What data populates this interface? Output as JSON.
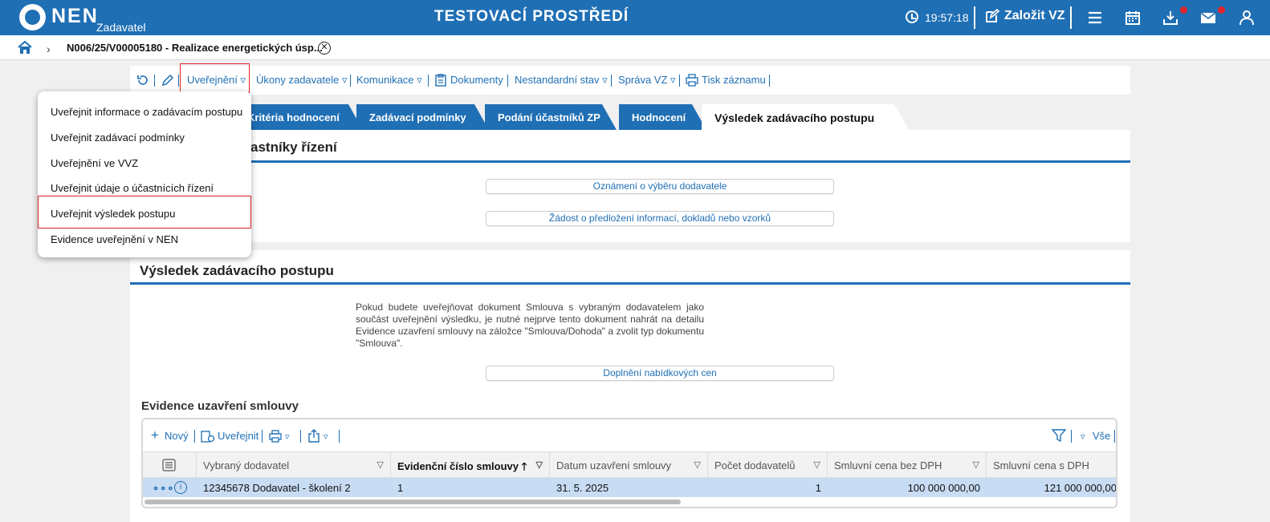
{
  "header": {
    "logo": "NEN",
    "logo_sub": "Zadavatel",
    "env_title": "TESTOVACÍ PROSTŘEDÍ",
    "time": "19:57:18",
    "create_label": "Založit VZ"
  },
  "breadcrumb": {
    "title": "N006/25/V00005180 - Realizace energetických úsp..."
  },
  "toolbar": {
    "publish": "Uveřejnění ▿",
    "actions": "Úkony zadavatele ▿",
    "communication": "Komunikace ▿",
    "documents": "Dokumenty",
    "nonstandard": "Nestandardní stav ▿",
    "management": "Správa VZ ▿",
    "print": "Tisk záznamu"
  },
  "tabs": [
    {
      "label": "Kritéria hodnocení"
    },
    {
      "label": "Zadávací podmínky"
    },
    {
      "label": "Podání účastníků ZP"
    },
    {
      "label": "Hodnocení"
    },
    {
      "label": "Výsledek zadávacího postupu"
    }
  ],
  "section1": {
    "title_partial": "astníky řízení",
    "btn1": "Oznámení o výběru dodavatele",
    "btn2": "Žádost o předložení informací, dokladů nebo vzorků"
  },
  "section2": {
    "title": "Výsledek zadávacího postupu",
    "note": "Pokud budete uveřejňovat dokument Smlouva s vybraným dodavatelem jako součást uveřejnění výsledku, je nutné nejprve tento dokument nahrát na detailu Evidence uzavření smlouvy na záložce \"Smlouva/Dohoda\" a zvolit typ dokumentu \"Smlouva\".",
    "btn": "Doplnění nabídkových cen"
  },
  "grid": {
    "title": "Evidence uzavření smlouvy",
    "new": "Nový",
    "publish": "Uveřejnit",
    "all": "Vše",
    "columns": [
      "Vybraný dodavatel",
      "Evidenční číslo smlouvy",
      "Datum uzavření smlouvy",
      "Počet dodavatelů",
      "Smluvní cena bez DPH",
      "Smluvní cena s DPH"
    ],
    "row": {
      "supplier": "12345678 Dodavatel - školení 2",
      "contract_no": "1",
      "date": "31. 5. 2025",
      "count": "1",
      "price_no_vat": "100 000 000,00",
      "price_vat": "121 000 000,00"
    }
  },
  "menu": {
    "items": [
      "Uveřejnit informace o zadávacím postupu",
      "Uveřejnit zadávací podmínky",
      "Uveřejnění ve VVZ",
      "Uveřejnit údaje o účastnících řízení",
      "Uveřejnit výsledek postupu",
      "Evidence uveřejnění v NEN"
    ]
  }
}
